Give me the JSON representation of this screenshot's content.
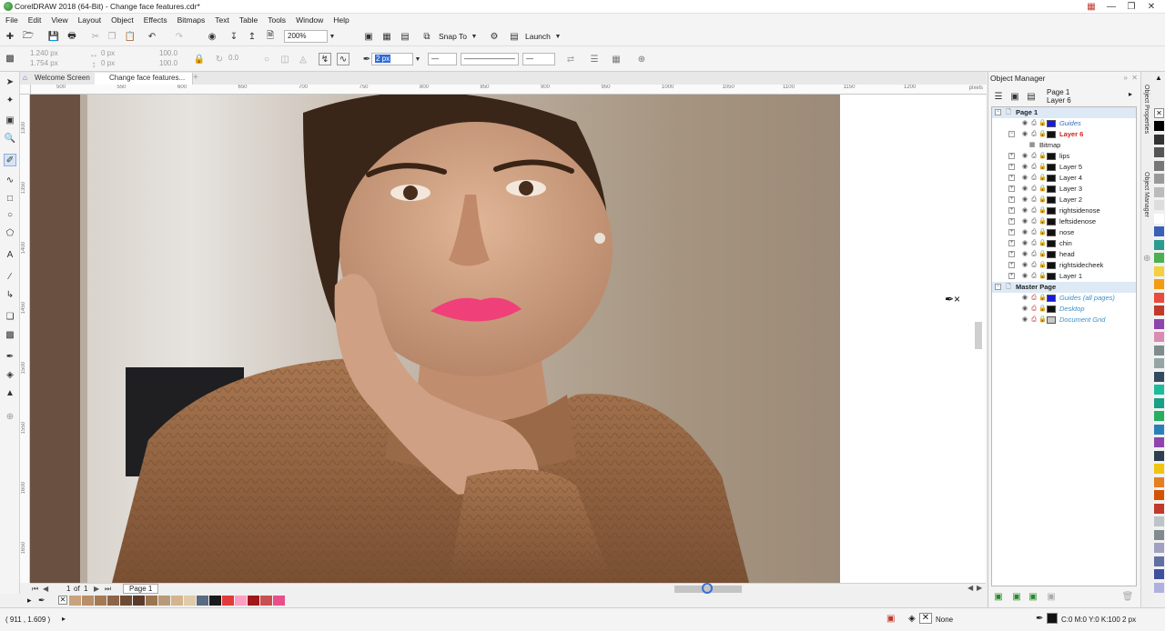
{
  "window": {
    "title": "CorelDRAW 2018 (64-Bit) - Change face features.cdr*",
    "controls": [
      "minimize",
      "maximize",
      "close"
    ]
  },
  "menu": [
    "File",
    "Edit",
    "View",
    "Layout",
    "Object",
    "Effects",
    "Bitmaps",
    "Text",
    "Table",
    "Tools",
    "Window",
    "Help"
  ],
  "toolbar": {
    "zoom": "200%",
    "snap_to": "Snap To",
    "launch": "Launch"
  },
  "property_bar": {
    "x": "1.240 px",
    "y": "1.754 px",
    "w": "0 px",
    "h": "0 px",
    "scale_w": "100.0",
    "scale_h": "100.0",
    "angle": "0.0",
    "outline_width": "2 px"
  },
  "document_tabs": [
    "Welcome Screen",
    "Change face features..."
  ],
  "ruler": {
    "unit": "pixels",
    "h_ticks": [
      "500",
      "550",
      "600",
      "650",
      "700",
      "750",
      "800",
      "850",
      "900",
      "950",
      "1000",
      "1050",
      "1100",
      "1150",
      "1200"
    ],
    "v_ticks": [
      "1300",
      "1350",
      "1400",
      "1450",
      "1500",
      "1550",
      "1600",
      "1650"
    ]
  },
  "page_nav": {
    "current": "1",
    "of_label": "of",
    "total": "1",
    "page_tab": "Page 1"
  },
  "object_manager": {
    "title": "Object Manager",
    "header_page": "Page 1",
    "header_layer": "Layer 6",
    "page_label": "Page 1",
    "rows": [
      {
        "label": "Guides",
        "color": "#1a1adc",
        "italic": true,
        "text_color": "#3a6fb8"
      },
      {
        "label": "Layer 6",
        "color": "#111111",
        "active": true
      },
      {
        "label": "Bitmap",
        "child": true
      },
      {
        "label": "lips",
        "color": "#111111"
      },
      {
        "label": "Layer 5",
        "color": "#111111"
      },
      {
        "label": "Layer 4",
        "color": "#111111"
      },
      {
        "label": "Layer 3",
        "color": "#111111"
      },
      {
        "label": "Layer 2",
        "color": "#111111"
      },
      {
        "label": "rightsidenose",
        "color": "#111111"
      },
      {
        "label": "leftsidenose",
        "color": "#111111"
      },
      {
        "label": "nose",
        "color": "#111111"
      },
      {
        "label": "chin",
        "color": "#111111"
      },
      {
        "label": "head",
        "color": "#111111"
      },
      {
        "label": "rightsidecheek",
        "color": "#111111"
      },
      {
        "label": "Layer 1",
        "color": "#111111"
      }
    ],
    "master_label": "Master Page",
    "master_rows": [
      {
        "label": "Guides (all pages)",
        "color": "#1a1adc"
      },
      {
        "label": "Desktop",
        "color": "#111111"
      },
      {
        "label": "Document Grid",
        "color": "#c8c8c8"
      }
    ]
  },
  "docker_tabs": [
    "Object Properties",
    "Object Manager"
  ],
  "status": {
    "coords": "( 911 , 1.609 )",
    "fill": "None",
    "outline": "C:0 M:0 Y:0 K:100  2 px"
  },
  "palette_colors": [
    "#c8a27c",
    "#b88f68",
    "#a47a55",
    "#8c6448",
    "#6e4b35",
    "#5a3b2a",
    "#9a7650",
    "#b89a78",
    "#d2b58e",
    "#e0cba8",
    "#5a6a80",
    "#1a1a1a",
    "#e23a3a",
    "#ff9ec0",
    "#a01818",
    "#c85050",
    "#e8508a"
  ],
  "vertical_palette": [
    "#000000",
    "#333333",
    "#555555",
    "#777777",
    "#999999",
    "#bbbbbb",
    "#dddddd",
    "#ffffff",
    "#3a5fb8",
    "#2a9d8f",
    "#4caf50",
    "#f4d03f",
    "#f39c12",
    "#e74c3c",
    "#c0392b",
    "#8e44ad",
    "#d98cb3",
    "#7f8c8d",
    "#95a5a6",
    "#34495e",
    "#1abc9c",
    "#16a085",
    "#27ae60",
    "#2980b9",
    "#8e44ad",
    "#2c3e50",
    "#f1c40f",
    "#e67e22",
    "#d35400",
    "#c0392b",
    "#bdc3c7",
    "#7f8c8d",
    "#a0a0c0",
    "#6070a0",
    "#4050a0",
    "#b0b0e0"
  ]
}
